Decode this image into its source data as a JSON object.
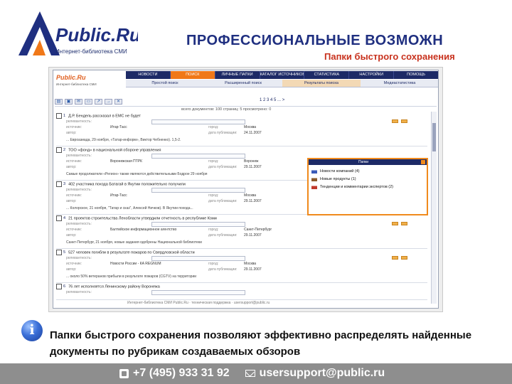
{
  "header": {
    "logo_text": "Public.Ru",
    "logo_tagline": "Интернет-библиотека СМИ",
    "title": "ПРОФЕССИОНАЛЬНЫЕ ВОЗМОЖН",
    "subtitle": "Папки быстрого сохранения"
  },
  "app": {
    "mini_logo": "Public.Ru",
    "mini_tagline": "Интернет-библиотека СМИ",
    "nav": [
      "НОВОСТИ",
      "ПОИСК",
      "ЛИЧНЫЕ ПАПКИ",
      "КАТАЛОГ ИСТОЧНИКОВ",
      "СТАТИСТИКА",
      "НАСТРОЙКИ",
      "ПОМОЩЬ"
    ],
    "subnav": [
      "Простой поиск",
      "Расширенный поиск",
      "Результаты поиска",
      "Медиастатистика"
    ],
    "pager": "1 2 3 4 5 ... >",
    "count_line": "всего документов: 100 страниц: 5 просмотрено: 0",
    "labels": {
      "relevance": "релевантность:",
      "source": "источник:",
      "author": "автор:",
      "city": "город:",
      "date": "дата публикации:"
    },
    "documents": [
      {
        "num": "1",
        "title": "Д.Р. Бендель рассказал в ЕМС не будет",
        "source": "Итар-Тасс",
        "city": "Москва",
        "date": "24.11.2007",
        "snippet": "... Евроазиада, 29 ноября, «Татар-информ», Виктор Чебненко). 1,5-2."
      },
      {
        "num": "2",
        "title": "ТОО «фонд» в национальной обороне управления",
        "source": "Воронежская ПТРК",
        "city": "Воронеж",
        "date": "29.11.2007",
        "snippet": "Самые продолжатели «Регион» также являются действительными Бодрое 29 ноября"
      },
      {
        "num": "3",
        "title": "402 участника похода Батагай в Якутии положительно получили",
        "source": "Итар-Тасс",
        "city": "Москва",
        "date": "29.11.2007",
        "snippet": "... Колорское, 21 ноября, \"Татар и сказ\", Алексей Ничков). В Якутии похода..."
      },
      {
        "num": "4",
        "title": "21 проектов строительства Ленобласти утвердили отчетность в республике Коми",
        "source": "Балтийское информационное агентство",
        "city": "Санкт-Петербург",
        "date": "29.11.2007",
        "snippet": "Санкт-Петербург, 21 ноября, новые задания одобрены Национальной библиотеки"
      },
      {
        "num": "5",
        "title": "527 человек погибли в результате пожаров по Свердловской области",
        "source": "Новости России - КА REGNUM",
        "city": "Москва",
        "date": "29.11.2007",
        "snippet": "... около 50% ветеранов прибыли в результате пожаров (CGTV) на территории"
      },
      {
        "num": "6",
        "title": "76 лет исполняется Ленинскому району Воронежа",
        "source": "",
        "city": "",
        "date": "",
        "snippet": ""
      }
    ],
    "popup": {
      "title": "Папки",
      "folders": [
        {
          "label": "Новости компаний (4)",
          "color": "#3a5bb8"
        },
        {
          "label": "Новые продукты (1)",
          "color": "#8a5a2a"
        },
        {
          "label": "Тенденции и комментарии экспертов (2)",
          "color": "#c0392b"
        }
      ]
    },
    "footer_text": "Интернет-библиотека СМИ Public.Ru · техническая поддержка · usersupport@public.ru"
  },
  "info": {
    "text": "Папки быстрого сохранения позволяют эффективно распределять найденные документы по рубрикам создаваемых обзоров"
  },
  "footer": {
    "phone": "+7 (495) 933 31 92",
    "email": "usersupport@public.ru"
  },
  "colors": {
    "brand_blue": "#1f2f80",
    "accent_red": "#c8321e",
    "accent_orange": "#f07818",
    "footer_gray": "#8e8e8e"
  },
  "icons": [
    "logo-triangle-icon",
    "info-icon",
    "phone-icon",
    "mail-icon",
    "folder-icon",
    "print-icon",
    "save-icon",
    "arrow-icon"
  ]
}
